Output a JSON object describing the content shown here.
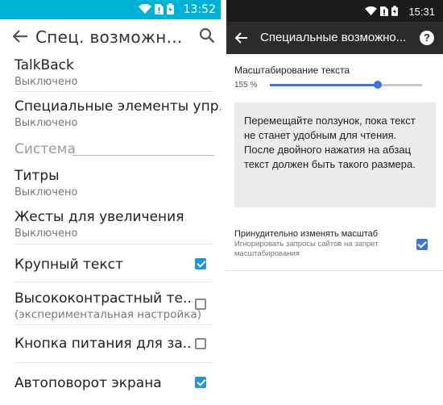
{
  "left_phone": {
    "status_bar": {
      "time": "13:52"
    },
    "header": {
      "title": "Спец. возможн..."
    },
    "section_system": "Система",
    "items": [
      {
        "title": "TalkBack",
        "subtitle": "Выключено"
      },
      {
        "title": "Специальные элементы упр..",
        "subtitle": "Выключено"
      },
      {
        "title": "Титры",
        "subtitle": "Выключено"
      },
      {
        "title": "Жесты для увеличения",
        "subtitle": "Выключено"
      },
      {
        "title": "Крупный текст",
        "checked": true
      },
      {
        "title": "Высококонтрастный те..",
        "subtitle": "(экспериментальная настройка)",
        "checked": false
      },
      {
        "title": "Кнопка питания для за..",
        "checked": false
      },
      {
        "title": "Автоповорот экрана",
        "checked": true
      }
    ]
  },
  "right_phone": {
    "status_bar": {
      "time": "15:31"
    },
    "header": {
      "title": "Специальные возможно...",
      "help_label": "?"
    },
    "text_scaling": {
      "label": "Масштабирование текста",
      "value_label": "155 %",
      "slider_fraction": 0.71
    },
    "preview_text": "Перемещайте ползунок, пока текст не станет удобным для чтения. После двойного нажатия на абзац текст должен быть такого размера.",
    "force_zoom": {
      "title": "Принудительно изменять масштаб",
      "subtitle": "Игнорировать запросы сайтов на запрет масштабирования",
      "checked": true
    }
  },
  "colors": {
    "left_status_bar": "#00b3d6",
    "right_status_bar": "#1b1b1b",
    "right_header": "#2b2b2b",
    "accent_left": "#2196d9",
    "accent_right": "#3a76d8"
  }
}
